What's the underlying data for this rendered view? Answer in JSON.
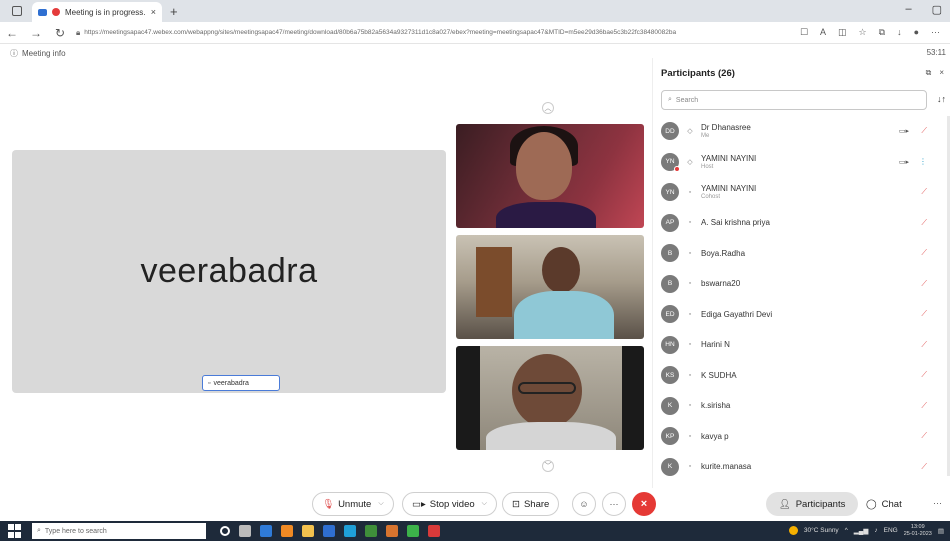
{
  "browser": {
    "tab_title": "Meeting is in progress...",
    "tab_close": "×",
    "new_tab": "+",
    "url": "https://meetingsapac47.webex.com/webappng/sites/meetingsapac47/meeting/download/80b6a75b82a5634a9327311d1c8a027/ebex?meeting=meetingsapac47&MTID=m5ee29d36bae5c3b22fc38480082ba",
    "win_min": "–",
    "win_max": "▢",
    "win_close": "×"
  },
  "meeting": {
    "info_label": "Meeting info",
    "clock": "53:11",
    "stage_name": "veerabadra",
    "stage_label": "veerabadra"
  },
  "participants": {
    "title": "Participants (26)",
    "search_placeholder": "Search",
    "list": [
      {
        "initials": "DD",
        "name": "Dr Dhanasree",
        "role": "Me",
        "cam": true,
        "mic_active": false,
        "badge": false
      },
      {
        "initials": "YN",
        "name": "YAMINI NAYINI",
        "role": "Host",
        "cam": true,
        "mic_active": true,
        "badge": true
      },
      {
        "initials": "YN",
        "name": "YAMINI NAYINI",
        "role": "Cohost",
        "cam": false,
        "mic_active": false,
        "badge": false
      },
      {
        "initials": "AP",
        "name": "A. Sai krishna priya",
        "role": "",
        "cam": false,
        "mic_active": false,
        "badge": false
      },
      {
        "initials": "B",
        "name": "Boya.Radha",
        "role": "",
        "cam": false,
        "mic_active": false,
        "badge": false
      },
      {
        "initials": "B",
        "name": "bswarna20",
        "role": "",
        "cam": false,
        "mic_active": false,
        "badge": false
      },
      {
        "initials": "ED",
        "name": "Ediga Gayathri Devi",
        "role": "",
        "cam": false,
        "mic_active": false,
        "badge": false
      },
      {
        "initials": "HN",
        "name": "Harini N",
        "role": "",
        "cam": false,
        "mic_active": false,
        "badge": false
      },
      {
        "initials": "KS",
        "name": "K SUDHA",
        "role": "",
        "cam": false,
        "mic_active": false,
        "badge": false
      },
      {
        "initials": "K",
        "name": "k.sirisha",
        "role": "",
        "cam": false,
        "mic_active": false,
        "badge": false
      },
      {
        "initials": "KP",
        "name": "kavya p",
        "role": "",
        "cam": false,
        "mic_active": false,
        "badge": false
      },
      {
        "initials": "K",
        "name": "kurite.manasa",
        "role": "",
        "cam": false,
        "mic_active": false,
        "badge": false
      }
    ]
  },
  "controls": {
    "unmute": "Unmute",
    "stop_video": "Stop video",
    "share": "Share",
    "participants": "Participants",
    "chat": "Chat",
    "more": "···",
    "end": "×"
  },
  "taskbar": {
    "search_placeholder": "Type here to search",
    "weather": "30°C Sunny",
    "lang": "ENG",
    "time": "13:09",
    "date": "25-01-2023"
  },
  "colors": {
    "leave_red": "#e53935",
    "mic_muted": "#e05252",
    "mic_active": "#27a0c9",
    "stage_bg": "#d9d9d9"
  }
}
